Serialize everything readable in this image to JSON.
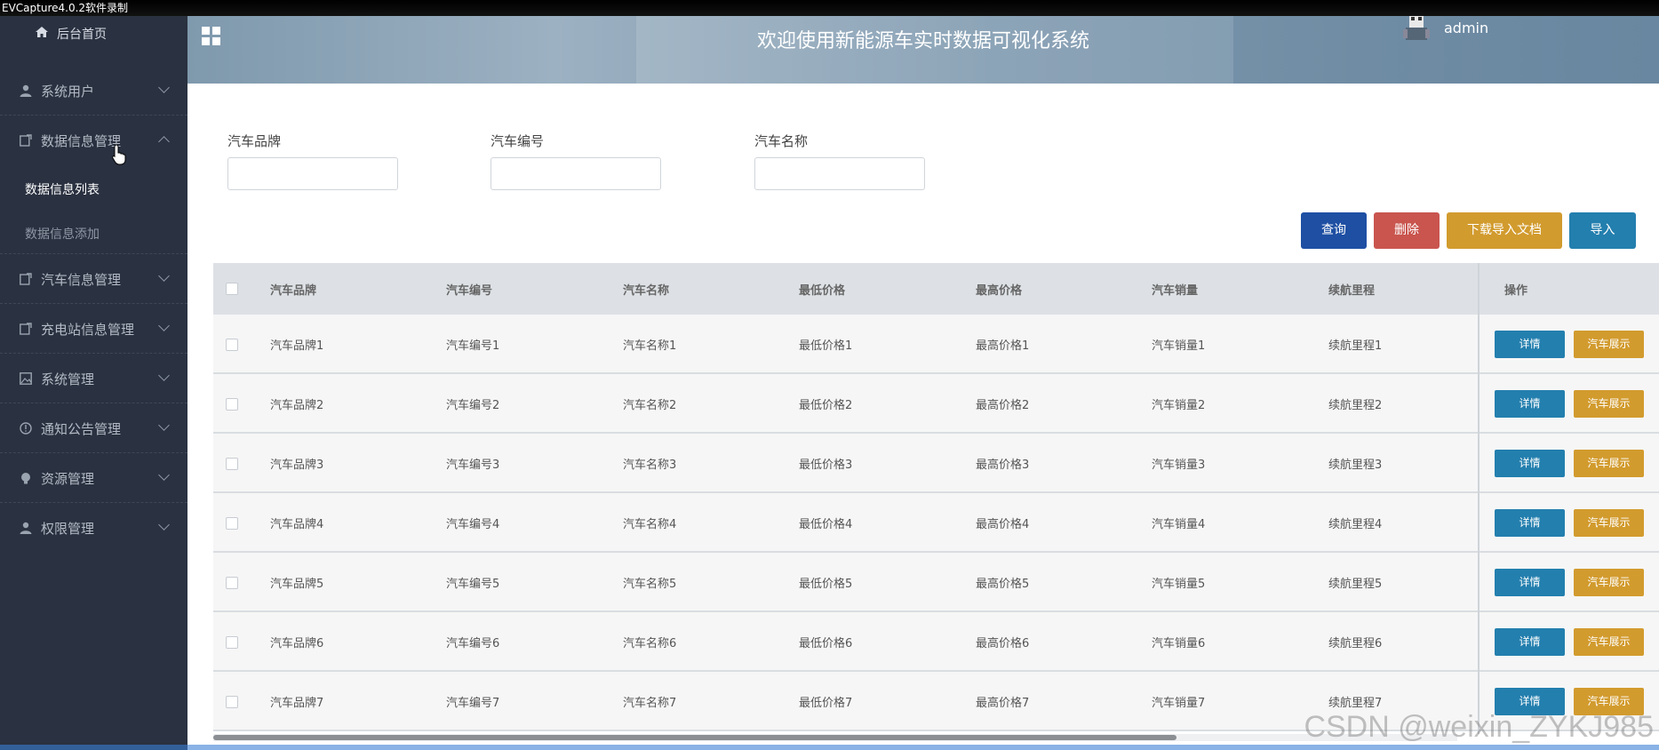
{
  "recording_bar": "EVCapture4.0.2软件录制",
  "header": {
    "title": "欢迎使用新能源车实时数据可视化系统",
    "user": "admin"
  },
  "sidebar": {
    "home": "后台首页",
    "items": [
      {
        "label": "系统用户",
        "icon": "user-icon",
        "expanded": false
      },
      {
        "label": "数据信息管理",
        "icon": "edit-icon",
        "expanded": true,
        "children": [
          {
            "label": "数据信息列表",
            "active": true
          },
          {
            "label": "数据信息添加",
            "active": false
          }
        ]
      },
      {
        "label": "汽车信息管理",
        "icon": "edit-icon",
        "expanded": false
      },
      {
        "label": "充电站信息管理",
        "icon": "edit-icon",
        "expanded": false
      },
      {
        "label": "系统管理",
        "icon": "image-icon",
        "expanded": false
      },
      {
        "label": "通知公告管理",
        "icon": "info-icon",
        "expanded": false
      },
      {
        "label": "资源管理",
        "icon": "bulb-icon",
        "expanded": false
      },
      {
        "label": "权限管理",
        "icon": "user-icon",
        "expanded": false
      }
    ]
  },
  "search": {
    "brand_label": "汽车品牌",
    "number_label": "汽车编号",
    "name_label": "汽车名称",
    "brand_value": "",
    "number_value": "",
    "name_value": ""
  },
  "buttons": {
    "query": "查询",
    "delete": "删除",
    "download": "下载导入文档",
    "import": "导入"
  },
  "colors": {
    "query": "#1e4fa3",
    "delete": "#c9554e",
    "download": "#d29b2e",
    "import": "#237fae",
    "sidebar_bg": "#2a3140"
  },
  "table": {
    "columns": [
      "汽车品牌",
      "汽车编号",
      "汽车名称",
      "最低价格",
      "最高价格",
      "汽车销量",
      "续航里程",
      "操作"
    ],
    "rows": [
      [
        "汽车品牌1",
        "汽车编号1",
        "汽车名称1",
        "最低价格1",
        "最高价格1",
        "汽车销量1",
        "续航里程1"
      ],
      [
        "汽车品牌2",
        "汽车编号2",
        "汽车名称2",
        "最低价格2",
        "最高价格2",
        "汽车销量2",
        "续航里程2"
      ],
      [
        "汽车品牌3",
        "汽车编号3",
        "汽车名称3",
        "最低价格3",
        "最高价格3",
        "汽车销量3",
        "续航里程3"
      ],
      [
        "汽车品牌4",
        "汽车编号4",
        "汽车名称4",
        "最低价格4",
        "最高价格4",
        "汽车销量4",
        "续航里程4"
      ],
      [
        "汽车品牌5",
        "汽车编号5",
        "汽车名称5",
        "最低价格5",
        "最高价格5",
        "汽车销量5",
        "续航里程5"
      ],
      [
        "汽车品牌6",
        "汽车编号6",
        "汽车名称6",
        "最低价格6",
        "最高价格6",
        "汽车销量6",
        "续航里程6"
      ],
      [
        "汽车品牌7",
        "汽车编号7",
        "汽车名称7",
        "最低价格7",
        "最高价格7",
        "汽车销量7",
        "续航里程7"
      ]
    ],
    "row_actions": {
      "detail": "详情",
      "show": "汽车展示"
    }
  },
  "watermark": "CSDN @weixin_ZYKJ985"
}
